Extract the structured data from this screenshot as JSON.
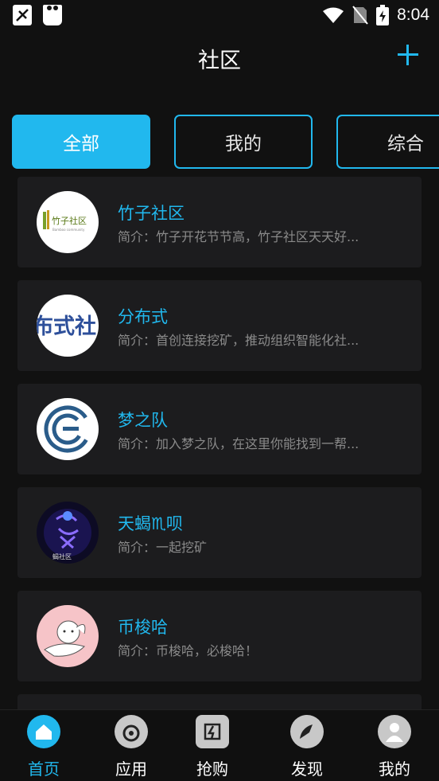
{
  "status_bar": {
    "time": "8:04"
  },
  "header": {
    "title": "社区"
  },
  "tabs": [
    {
      "label": "全部"
    },
    {
      "label": "我的"
    },
    {
      "label": "综合"
    }
  ],
  "communities": [
    {
      "name": "竹子社区",
      "desc": "简介：竹子开花节节高，竹子社区天天好...",
      "avatar_text": "竹子社区",
      "avatar_subtext": "Bamboo community"
    },
    {
      "name": "分布式",
      "desc": "简介：首创连接挖矿，推动组织智能化社...",
      "avatar_text": "布式社"
    },
    {
      "name": "梦之队",
      "desc": "简介：加入梦之队，在这里你能找到一帮...",
      "avatar_text": ""
    },
    {
      "name": "天蝎♏呗",
      "desc": "简介：一起挖矿",
      "avatar_text": "蝎社区"
    },
    {
      "name": "币梭哈",
      "desc": "简介：币梭哈，必梭哈！",
      "avatar_text": ""
    }
  ],
  "bottom_nav": [
    {
      "label": "首页",
      "icon": "home-icon"
    },
    {
      "label": "应用",
      "icon": "apps-icon"
    },
    {
      "label": "抢购",
      "icon": "flash-sale-icon"
    },
    {
      "label": "发现",
      "icon": "discover-icon"
    },
    {
      "label": "我的",
      "icon": "profile-icon"
    }
  ],
  "colors": {
    "accent": "#21b8ee",
    "background": "#111111",
    "card": "#1c1c1e"
  }
}
